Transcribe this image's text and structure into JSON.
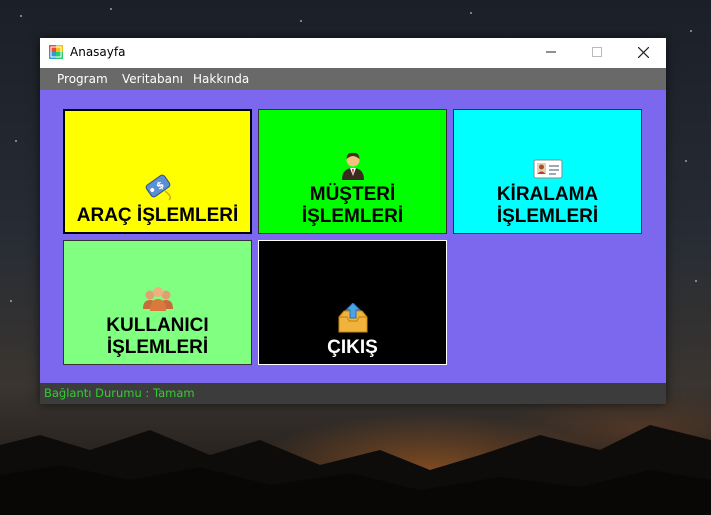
{
  "window": {
    "title": "Anasayfa"
  },
  "menu": {
    "items": [
      "Program",
      "Veritabanı",
      "Hakkında"
    ]
  },
  "tiles": [
    {
      "line1": "ARAÇ İŞLEMLERİ",
      "line2": "",
      "bg": "#ffff00",
      "color": "#000000",
      "icon": "price-tag-icon"
    },
    {
      "line1": "MÜŞTERİ",
      "line2": "İŞLEMLERİ",
      "bg": "#00ff00",
      "color": "#000000",
      "icon": "customer-icon"
    },
    {
      "line1": "KİRALAMA",
      "line2": "İŞLEMLERİ",
      "bg": "#00ffff",
      "color": "#000000",
      "icon": "id-card-icon"
    },
    {
      "line1": "KULLANICI",
      "line2": "İŞLEMLERİ",
      "bg": "#80ff80",
      "color": "#000000",
      "icon": "users-icon"
    },
    {
      "line1": "ÇIKIŞ",
      "line2": "",
      "bg": "#000000",
      "color": "#ffffff",
      "icon": "exit-inbox-icon"
    }
  ],
  "status": {
    "text": "Bağlantı Durumu : Tamam"
  },
  "colors": {
    "window_bg": "#7b68ee",
    "menubar": "#696969",
    "statusbar": "#3c3c3c",
    "status_text": "#32cd32"
  }
}
